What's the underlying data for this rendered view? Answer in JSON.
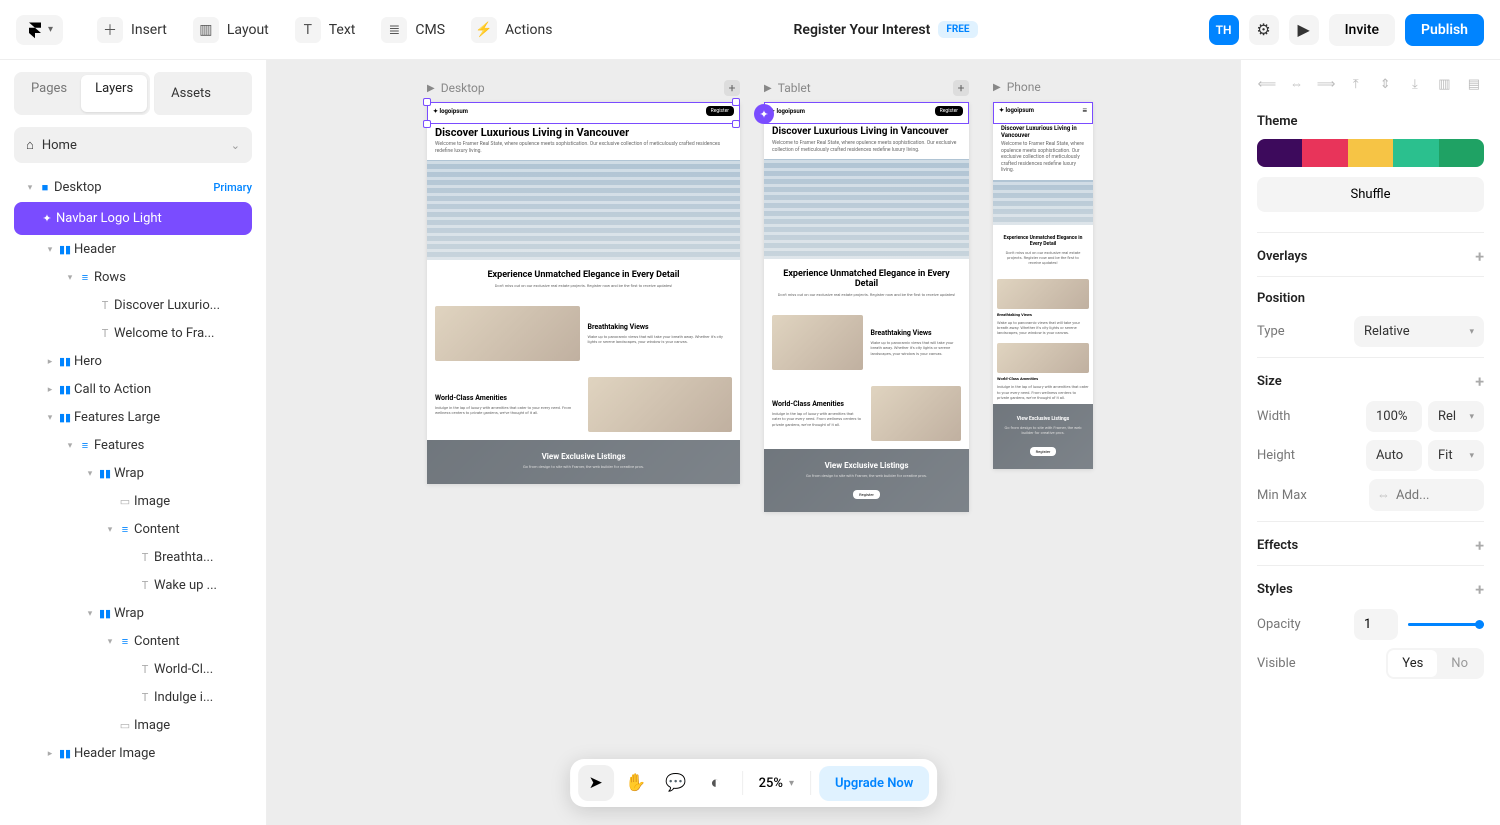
{
  "toolbar": {
    "items": [
      {
        "icon": "＋",
        "label": "Insert"
      },
      {
        "icon": "▥",
        "label": "Layout"
      },
      {
        "icon": "T",
        "label": "Text"
      },
      {
        "icon": "≣",
        "label": "CMS"
      },
      {
        "icon": "⚡",
        "label": "Actions"
      }
    ],
    "project_title": "Register Your Interest",
    "free_badge": "FREE",
    "avatar": "TH",
    "invite": "Invite",
    "publish": "Publish"
  },
  "left": {
    "tabs": {
      "pages": "Pages",
      "layers": "Layers",
      "assets": "Assets"
    },
    "home": "Home",
    "tree": [
      {
        "depth": 1,
        "tw": "▾",
        "ic": "■",
        "label": "Desktop",
        "badge": "Primary"
      },
      {
        "depth": 2,
        "tw": "",
        "ic": "✦",
        "label": "Navbar Logo Light",
        "sel": true
      },
      {
        "depth": 2,
        "tw": "▾",
        "ic": "▮▮",
        "label": "Header"
      },
      {
        "depth": 3,
        "tw": "▾",
        "ic": "≡",
        "label": "Rows"
      },
      {
        "depth": 4,
        "tw": "",
        "ic": "T",
        "label": "Discover Luxurio...",
        "txt": true
      },
      {
        "depth": 4,
        "tw": "",
        "ic": "T",
        "label": "Welcome to Fra...",
        "txt": true
      },
      {
        "depth": 2,
        "tw": "▸",
        "ic": "▮▮",
        "label": "Hero"
      },
      {
        "depth": 2,
        "tw": "▸",
        "ic": "▮▮",
        "label": "Call to Action"
      },
      {
        "depth": 2,
        "tw": "▾",
        "ic": "▮▮",
        "label": "Features Large"
      },
      {
        "depth": 3,
        "tw": "▾",
        "ic": "≡",
        "label": "Features"
      },
      {
        "depth": 4,
        "tw": "▾",
        "ic": "▮▮",
        "label": "Wrap"
      },
      {
        "depth": 5,
        "tw": "",
        "ic": "▭",
        "label": "Image",
        "stk": true
      },
      {
        "depth": 5,
        "tw": "▾",
        "ic": "≡",
        "label": "Content"
      },
      {
        "depth": 6,
        "tw": "",
        "ic": "T",
        "label": "Breathta...",
        "txt": true
      },
      {
        "depth": 6,
        "tw": "",
        "ic": "T",
        "label": "Wake up ...",
        "txt": true
      },
      {
        "depth": 4,
        "tw": "▾",
        "ic": "▮▮",
        "label": "Wrap"
      },
      {
        "depth": 5,
        "tw": "▾",
        "ic": "≡",
        "label": "Content"
      },
      {
        "depth": 6,
        "tw": "",
        "ic": "T",
        "label": "World-Cl...",
        "txt": true
      },
      {
        "depth": 6,
        "tw": "",
        "ic": "T",
        "label": "Indulge i...",
        "txt": true
      },
      {
        "depth": 5,
        "tw": "",
        "ic": "▭",
        "label": "Image",
        "stk": true
      },
      {
        "depth": 2,
        "tw": "▸",
        "ic": "▮▮",
        "label": "Header Image"
      }
    ]
  },
  "canvas": {
    "breakpoints": [
      "Desktop",
      "Tablet",
      "Phone"
    ],
    "content": {
      "logo": "✦ logoipsum",
      "register": "Register",
      "h1": "Discover Luxurious Living in Vancouver",
      "intro": "Welcome to Framer Real State, where opulence meets sophistication. Our exclusive collection of meticulously crafted residences redefine luxury living.",
      "h2": "Experience Unmatched Elegance in Every Detail",
      "sub": "Don't miss out on our exclusive real estate projects. Register now and be the first to receive updates!",
      "f1_title": "Breathtaking Views",
      "f1_body": "Wake up to panoramic views that will take your breath away. Whether it's city lights or serene landscapes, your window is your canvas.",
      "f2_title": "World-Class Amenities",
      "f2_body": "Indulge in the lap of luxury with amenities that cater to your every need. From wellness centers to private gardens, we've thought of it all.",
      "cta_title": "View Exclusive Listings",
      "cta_body": "Go from design to site with Framer, the web builder for creative pros.",
      "cta_btn": "Register"
    }
  },
  "bottom": {
    "zoom": "25%",
    "upgrade": "Upgrade Now"
  },
  "right": {
    "theme": "Theme",
    "swatches": [
      "#3d0a5c",
      "#e8345a",
      "#f6c445",
      "#2bc08e",
      "#1fa264"
    ],
    "shuffle": "Shuffle",
    "overlays": "Overlays",
    "position": "Position",
    "type_label": "Type",
    "type_value": "Relative",
    "size": "Size",
    "width_label": "Width",
    "width_value": "100%",
    "width_unit": "Rel",
    "height_label": "Height",
    "height_value": "Auto",
    "height_unit": "Fit",
    "minmax_label": "Min Max",
    "minmax_placeholder": "Add...",
    "effects": "Effects",
    "styles": "Styles",
    "opacity_label": "Opacity",
    "opacity_value": "1",
    "visible_label": "Visible",
    "visible_yes": "Yes",
    "visible_no": "No"
  }
}
